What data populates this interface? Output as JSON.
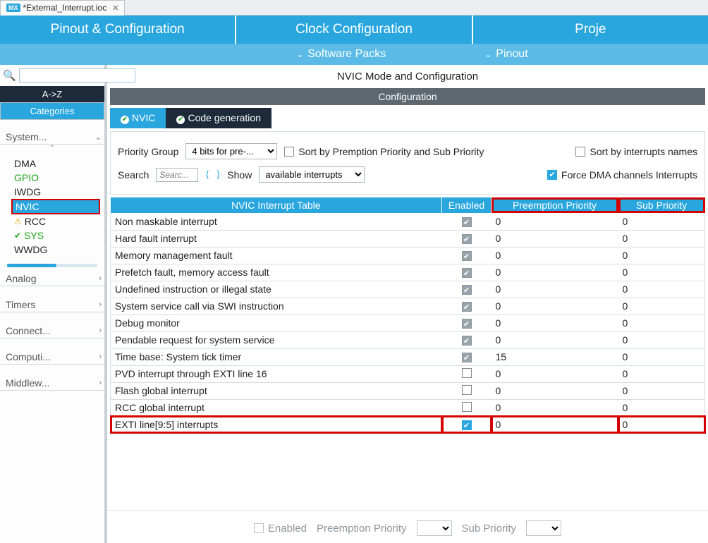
{
  "file_tab": {
    "prefix": "MX",
    "name": "*External_Interrupt.ioc"
  },
  "main_tabs": [
    "Pinout & Configuration",
    "Clock Configuration",
    "Proje"
  ],
  "sub_bar": [
    "Software Packs",
    "Pinout"
  ],
  "sidebar": {
    "sort_label": "A->Z",
    "cat_label": "Categories",
    "groups": [
      {
        "label": "System...",
        "expanded": true,
        "items": [
          {
            "label": "DMA",
            "icon": ""
          },
          {
            "label": "GPIO",
            "icon": "",
            "style": "green"
          },
          {
            "label": "IWDG",
            "icon": ""
          },
          {
            "label": "NVIC",
            "icon": "",
            "selected": true
          },
          {
            "label": "RCC",
            "icon": "warn"
          },
          {
            "label": "SYS",
            "icon": "check",
            "style": "green"
          },
          {
            "label": "WWDG",
            "icon": ""
          }
        ]
      },
      {
        "label": "Analog"
      },
      {
        "label": "Timers"
      },
      {
        "label": "Connect..."
      },
      {
        "label": "Computi..."
      },
      {
        "label": "Middlew..."
      }
    ]
  },
  "content": {
    "title": "NVIC Mode and Configuration",
    "conf_label": "Configuration",
    "tabs": {
      "nvic": "NVIC",
      "codegen": "Code generation"
    },
    "filters": {
      "priority_group_label": "Priority Group",
      "priority_group_value": "4 bits for pre-...",
      "sort_priority": "Sort by Premption Priority and Sub Priority",
      "sort_names": "Sort by interrupts names",
      "search_label": "Search",
      "search_placeholder": "Searc...",
      "show_label": "Show",
      "show_value": "available interrupts",
      "force_dma": "Force DMA channels Interrupts"
    },
    "table": {
      "headers": [
        "NVIC Interrupt Table",
        "Enabled",
        "Preemption Priority",
        "Sub Priority"
      ],
      "rows": [
        {
          "name": "Non maskable interrupt",
          "enabled": "grey",
          "pre": "0",
          "sub": "0"
        },
        {
          "name": "Hard fault interrupt",
          "enabled": "grey",
          "pre": "0",
          "sub": "0"
        },
        {
          "name": "Memory management fault",
          "enabled": "grey",
          "pre": "0",
          "sub": "0"
        },
        {
          "name": "Prefetch fault, memory access fault",
          "enabled": "grey",
          "pre": "0",
          "sub": "0"
        },
        {
          "name": "Undefined instruction or illegal state",
          "enabled": "grey",
          "pre": "0",
          "sub": "0"
        },
        {
          "name": "System service call via SWI instruction",
          "enabled": "grey",
          "pre": "0",
          "sub": "0"
        },
        {
          "name": "Debug monitor",
          "enabled": "grey",
          "pre": "0",
          "sub": "0"
        },
        {
          "name": "Pendable request for system service",
          "enabled": "grey",
          "pre": "0",
          "sub": "0"
        },
        {
          "name": "Time base: System tick timer",
          "enabled": "grey",
          "pre": "15",
          "sub": "0"
        },
        {
          "name": "PVD interrupt through EXTI line 16",
          "enabled": "off",
          "pre": "0",
          "sub": "0"
        },
        {
          "name": "Flash global interrupt",
          "enabled": "off",
          "pre": "0",
          "sub": "0"
        },
        {
          "name": "RCC global interrupt",
          "enabled": "off",
          "pre": "0",
          "sub": "0"
        },
        {
          "name": "EXTI line[9:5] interrupts",
          "enabled": "blue",
          "pre": "0",
          "sub": "0",
          "highlight": true
        }
      ]
    },
    "footer": {
      "enabled": "Enabled",
      "pre": "Preemption Priority",
      "sub": "Sub Priority"
    }
  }
}
